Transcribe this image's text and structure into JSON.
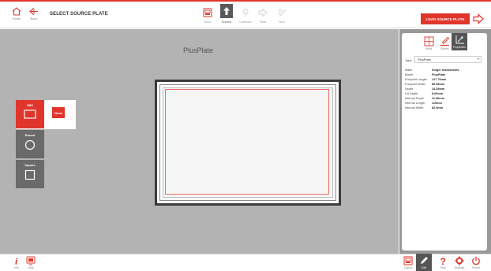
{
  "header": {
    "nav": [
      {
        "id": "home",
        "label": "Home",
        "icon": "home-icon"
      },
      {
        "id": "back",
        "label": "Back",
        "icon": "back-arrow-icon"
      }
    ],
    "title": "SELECT SOURCE PLATE",
    "steps": [
      {
        "id": "deck",
        "label": "Deck",
        "icon": "deck-layout-icon"
      },
      {
        "id": "source",
        "label": "Source",
        "icon": "up-arrow-icon",
        "active": true
      },
      {
        "id": "labware",
        "label": "Labware",
        "icon": "pin-icon"
      },
      {
        "id": "destination",
        "label": "Dest",
        "icon": "arrow-right-icon"
      },
      {
        "id": "run",
        "label": "Run",
        "icon": "check-icon"
      }
    ],
    "load_button": "LOAD SOURCE PLATE",
    "accent_color": "#e0352b"
  },
  "plate": {
    "name": "PlusPlate"
  },
  "well_tools": {
    "sbs": {
      "label": "SBS",
      "none_button": "None"
    },
    "round": {
      "label": "Round"
    },
    "square": {
      "label": "Square"
    }
  },
  "panel": {
    "tabs": [
      {
        "id": "wells",
        "label": "Wells",
        "icon": "grid-icon"
      },
      {
        "id": "offsets",
        "label": "Offsets",
        "icon": "pipette-icon"
      },
      {
        "id": "properties",
        "label": "Properties",
        "icon": "dimensions-icon",
        "active": true
      }
    ],
    "type_label": "Type",
    "type_value": "PlusPlate",
    "properties": [
      {
        "key": "Make",
        "value": "Singer Instruments"
      },
      {
        "key": "Model",
        "value": "PlusPlate"
      },
      {
        "key": "Footprint Length",
        "value": "127.76mm"
      },
      {
        "key": "Footprint Width",
        "value": "85.48mm"
      },
      {
        "key": "Depth",
        "value": "14.35mm"
      },
      {
        "key": "Lid Depth",
        "value": "8.00mm"
      },
      {
        "key": "Internal Depth",
        "value": "11.50mm"
      },
      {
        "key": "Internal Length",
        "value": "119mm"
      },
      {
        "key": "Internal Width",
        "value": "82.5mm"
      }
    ]
  },
  "footer": {
    "left": [
      {
        "id": "info",
        "label": "Info",
        "icon": "info-icon"
      },
      {
        "id": "help",
        "label": "Help",
        "icon": "help-screen-icon"
      }
    ],
    "right": [
      {
        "id": "layout",
        "label": "Layout",
        "icon": "layout-icon"
      },
      {
        "id": "edit",
        "label": "Edit",
        "icon": "pencil-icon",
        "active": true
      },
      {
        "id": "help",
        "label": "Help",
        "icon": "question-icon"
      },
      {
        "id": "settings",
        "label": "Settings",
        "icon": "gear-icon"
      },
      {
        "id": "power",
        "label": "Power",
        "icon": "power-icon"
      }
    ]
  }
}
